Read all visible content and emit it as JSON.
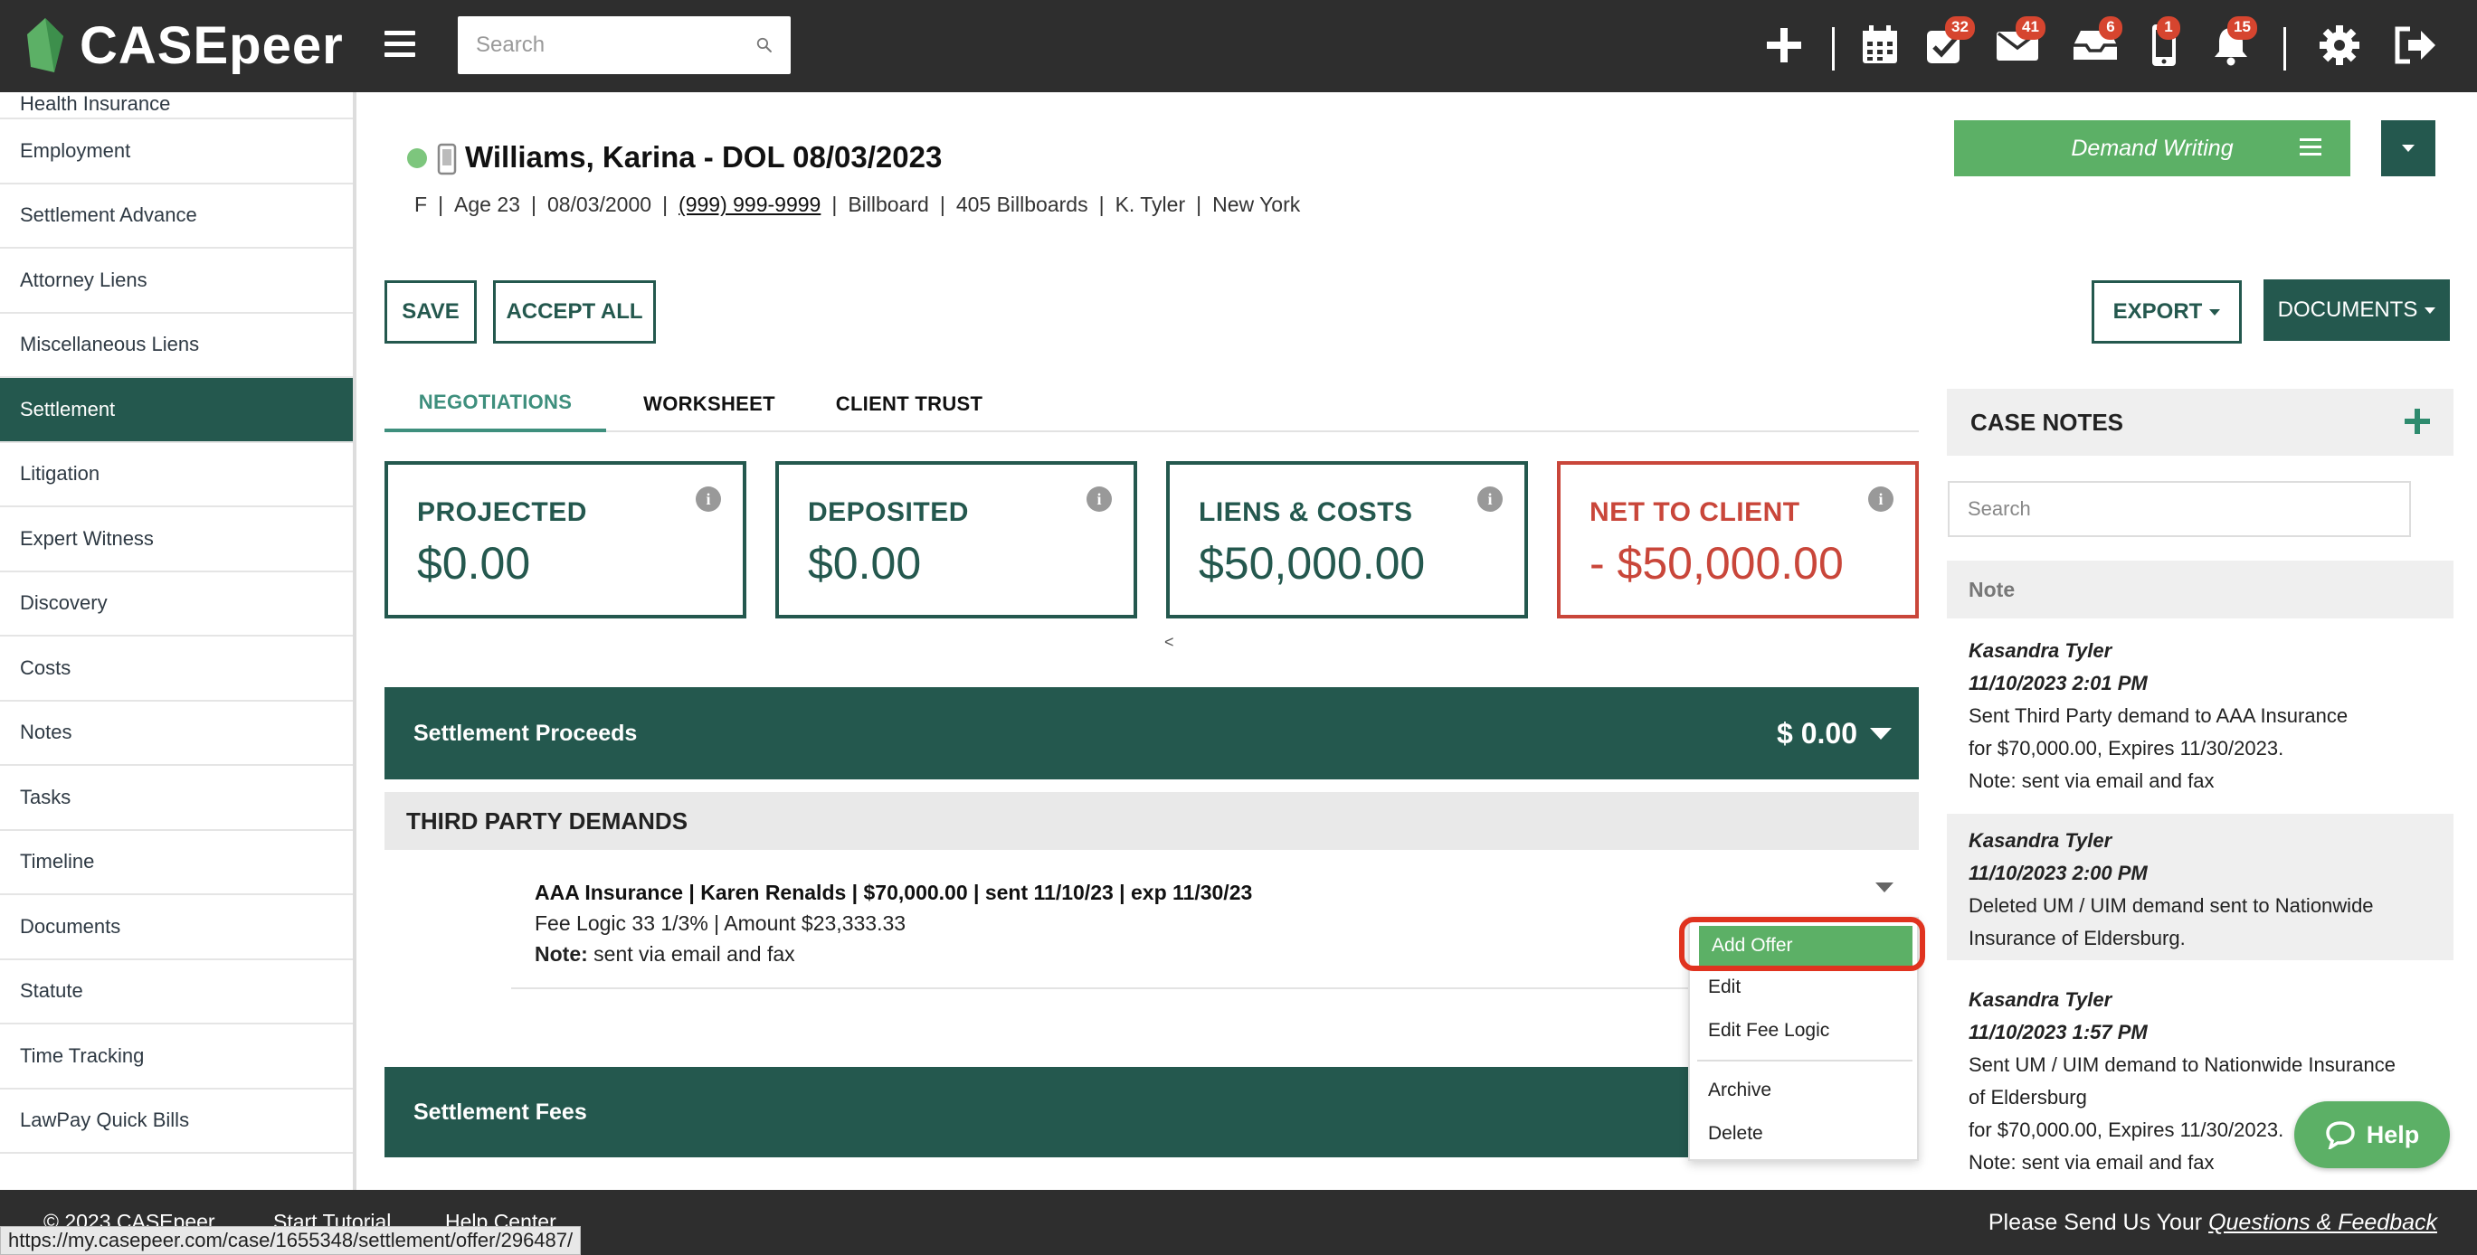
{
  "app": {
    "name": "CASEpeer",
    "search_placeholder": "Search",
    "colors": {
      "topbar": "#2e2e2e",
      "brand_green": "#24584e",
      "accent_green": "#5cb066",
      "alert_red": "#c9463a",
      "badge_red": "#d6452f"
    },
    "badges": {
      "tasks": "32",
      "mail": "41",
      "inbox": "6",
      "phone": "1",
      "notifications": "15"
    },
    "icons": [
      "plus-icon",
      "calendar-icon",
      "tasks-icon",
      "mail-icon",
      "inbox-icon",
      "phone-icon",
      "bell-icon",
      "gear-icon",
      "logout-icon"
    ]
  },
  "sidebar": {
    "items": [
      {
        "label": "Health Insurance"
      },
      {
        "label": "Employment"
      },
      {
        "label": "Settlement Advance"
      },
      {
        "label": "Attorney Liens"
      },
      {
        "label": "Miscellaneous Liens"
      },
      {
        "label": "Settlement",
        "active": true
      },
      {
        "label": "Litigation"
      },
      {
        "label": "Expert Witness"
      },
      {
        "label": "Discovery"
      },
      {
        "label": "Costs"
      },
      {
        "label": "Notes"
      },
      {
        "label": "Tasks"
      },
      {
        "label": "Timeline"
      },
      {
        "label": "Documents"
      },
      {
        "label": "Statute"
      },
      {
        "label": "Time Tracking"
      },
      {
        "label": "LawPay Quick Bills"
      }
    ]
  },
  "case": {
    "title": "Williams, Karina - DOL 08/03/2023",
    "meta": {
      "sex": "F",
      "age": "Age 23",
      "dob": "08/03/2000",
      "phone": "(999) 999-9999",
      "source": "Billboard",
      "source_detail": "405 Billboards",
      "attorney": "K. Tyler",
      "state": "New York"
    },
    "stage_button": "Demand Writing"
  },
  "actions": {
    "save": "SAVE",
    "accept_all": "ACCEPT ALL",
    "export": "EXPORT",
    "documents": "DOCUMENTS"
  },
  "tabs": [
    {
      "label": "NEGOTIATIONS",
      "active": true
    },
    {
      "label": "WORKSHEET"
    },
    {
      "label": "CLIENT TRUST"
    }
  ],
  "cards": {
    "projected": {
      "label": "PROJECTED",
      "value": "$0.00"
    },
    "deposited": {
      "label": "DEPOSITED",
      "value": "$0.00"
    },
    "liens": {
      "label": "LIENS & COSTS",
      "value": "$50,000.00"
    },
    "net": {
      "label": "NET TO CLIENT",
      "value": "- $50,000.00"
    },
    "info_glyph": "i",
    "scroll_indicator": "<"
  },
  "settlement": {
    "proceeds_label": "Settlement Proceeds",
    "proceeds_amount": "$ 0.00",
    "third_party_heading": "THIRD PARTY DEMANDS",
    "demand": {
      "line1": "AAA Insurance | Karen Renalds | $70,000.00 | sent 11/10/23 | exp 11/30/23",
      "line2": "Fee Logic 33 1/3% | Amount $23,333.33",
      "note_label": "Note:",
      "note_text": "sent via email and fax"
    },
    "fees_label": "Settlement Fees"
  },
  "dropdown": {
    "add_offer": "Add Offer",
    "edit": "Edit",
    "edit_fee_logic": "Edit Fee Logic",
    "archive": "Archive",
    "delete": "Delete"
  },
  "case_notes": {
    "heading": "CASE NOTES",
    "search_placeholder": "Search",
    "column": "Note",
    "notes": [
      {
        "author": "Kasandra Tyler",
        "time": "11/10/2023 2:01 PM",
        "lines": [
          "Sent Third Party demand to AAA Insurance",
          "for $70,000.00, Expires 11/30/2023.",
          "Note: sent via email and fax"
        ]
      },
      {
        "author": "Kasandra Tyler",
        "time": "11/10/2023 2:00 PM",
        "lines": [
          "Deleted UM / UIM demand sent to Nationwide",
          "Insurance of Eldersburg."
        ]
      },
      {
        "author": "Kasandra Tyler",
        "time": "11/10/2023 1:57 PM",
        "lines": [
          "Sent UM / UIM demand to Nationwide Insurance",
          "of Eldersburg",
          "for $70,000.00, Expires 11/30/2023.",
          "Note: sent via email and fax"
        ]
      }
    ]
  },
  "help": {
    "label": "Help"
  },
  "footer": {
    "copyright": "© 2023 CASEpeer",
    "start_tutorial": "Start Tutorial",
    "help_center": "Help Center",
    "feedback_prefix": "Please Send Us Your",
    "feedback_link": "Questions & Feedback"
  },
  "status_url": "https://my.casepeer.com/case/1655348/settlement/offer/296487/"
}
